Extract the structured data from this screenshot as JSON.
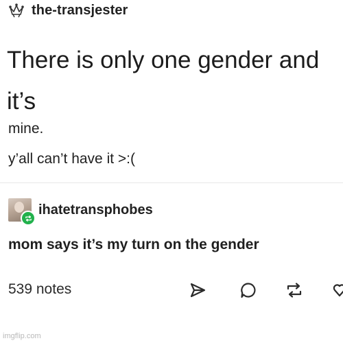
{
  "original_post": {
    "username": "the-transjester",
    "avatar_icon": "jester-hat-icon",
    "title": "There is only one gender and it’s",
    "lines": [
      "mine.",
      "y’all can’t have it >:("
    ]
  },
  "reblog": {
    "username": "ihatetransphobes",
    "badge_icon": "reblog-badge-icon",
    "text": "mom says it’s my turn on the gender"
  },
  "footer": {
    "notes": "539 notes",
    "actions": [
      "share-icon",
      "reply-icon",
      "reblog-icon",
      "like-icon"
    ]
  },
  "watermark": "imgflip.com",
  "colors": {
    "badge": "#22b14c",
    "text": "#1b1b1b",
    "watermark": "#b9b9b9"
  }
}
